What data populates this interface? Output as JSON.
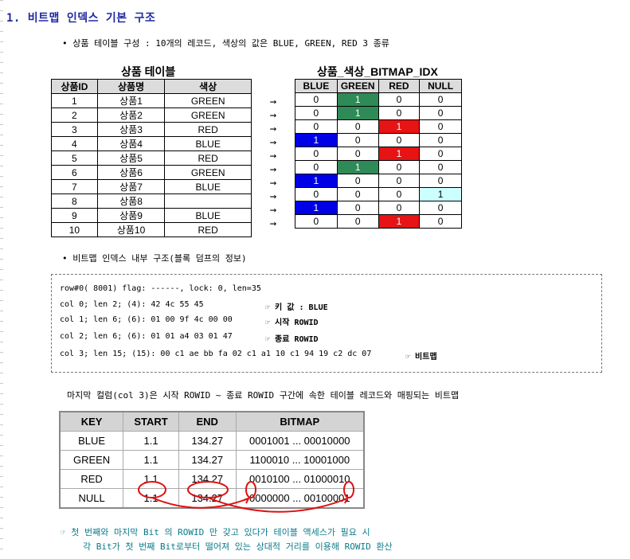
{
  "title": "1. 비트맵 인덱스 기본 구조",
  "bullet1": "• 상품 테이블 구성 : 10개의 레코드, 색상의 값은 BLUE, GREEN, RED 3 종류",
  "product_table": {
    "caption": "상품 테이블",
    "headers": [
      "상품ID",
      "상품명",
      "색상"
    ],
    "rows": [
      [
        "1",
        "상품1",
        "GREEN"
      ],
      [
        "2",
        "상품2",
        "GREEN"
      ],
      [
        "3",
        "상품3",
        "RED"
      ],
      [
        "4",
        "상품4",
        "BLUE"
      ],
      [
        "5",
        "상품5",
        "RED"
      ],
      [
        "6",
        "상품6",
        "GREEN"
      ],
      [
        "7",
        "상품7",
        "BLUE"
      ],
      [
        "8",
        "상품8",
        ""
      ],
      [
        "9",
        "상품9",
        "BLUE"
      ],
      [
        "10",
        "상품10",
        "RED"
      ]
    ]
  },
  "arrow": "→",
  "bitmap_table": {
    "caption": "상품_색상_BITMAP_IDX",
    "headers": [
      "BLUE",
      "GREEN",
      "RED",
      "NULL"
    ],
    "rows": [
      [
        "0",
        "1",
        "0",
        "0"
      ],
      [
        "0",
        "1",
        "0",
        "0"
      ],
      [
        "0",
        "0",
        "1",
        "0"
      ],
      [
        "1",
        "0",
        "0",
        "0"
      ],
      [
        "0",
        "0",
        "1",
        "0"
      ],
      [
        "0",
        "1",
        "0",
        "0"
      ],
      [
        "1",
        "0",
        "0",
        "0"
      ],
      [
        "0",
        "0",
        "0",
        "1"
      ],
      [
        "1",
        "0",
        "0",
        "0"
      ],
      [
        "0",
        "0",
        "1",
        "0"
      ]
    ]
  },
  "colors": {
    "blue": "#0000e6",
    "green": "#2e8b57",
    "red": "#e61414",
    "null": "#ccffff",
    "title": "#1f2aa0",
    "note": "#0a7a8a",
    "circle": "#e01010"
  },
  "bullet2": "• 비트맵 인덱스 내부 구조(블록 덤프의 정보)",
  "dump": {
    "line0": "row#0( 8001) flag: ------, lock: 0, len=35",
    "line1": "col 0; len 2;  (4):  42 4c 55 45",
    "line2": "col 1; len 6;  (6):  01 00 9f 4c 00 00",
    "line3": "col 2; len 6;  (6):  01 01 a4 03 01 47",
    "line4": "col 3; len 15;  (15):  00 c1 ae bb fa 02 c1 a1 10 c1 94 19 c2 dc 07",
    "note1": "☞ 키 값 : BLUE",
    "note2": "☞ 시작 ROWID",
    "note3": "☞ 종료 ROWID",
    "note4": "☞ 비트맵"
  },
  "desc": "마지막 컬럼(col 3)은 시작 ROWID ~ 종료 ROWID 구간에 속한 테이블 레코드와 매핑되는 비트맵",
  "key_table": {
    "headers": [
      "KEY",
      "START",
      "END",
      "BITMAP"
    ],
    "rows": [
      [
        "BLUE",
        "1.1",
        "134.27",
        "0001001 ... 00010000"
      ],
      [
        "GREEN",
        "1.1",
        "134.27",
        "1100010 ... 10001000"
      ],
      [
        "RED",
        "1.1",
        "134.27",
        "0010100 ... 01000010"
      ],
      [
        "NULL",
        "1.1",
        "134.27",
        "0000000 ... 00100001"
      ]
    ]
  },
  "footnote": {
    "line1": "☞ 첫 번째와 마지막 Bit 의 ROWID 만 갖고 있다가 테이블 액세스가 필요 시",
    "line2": "각 Bit가 첫 번째 Bit로부터 떨어져 있는 상대적 거리를 이용해 ROWID 환산"
  }
}
